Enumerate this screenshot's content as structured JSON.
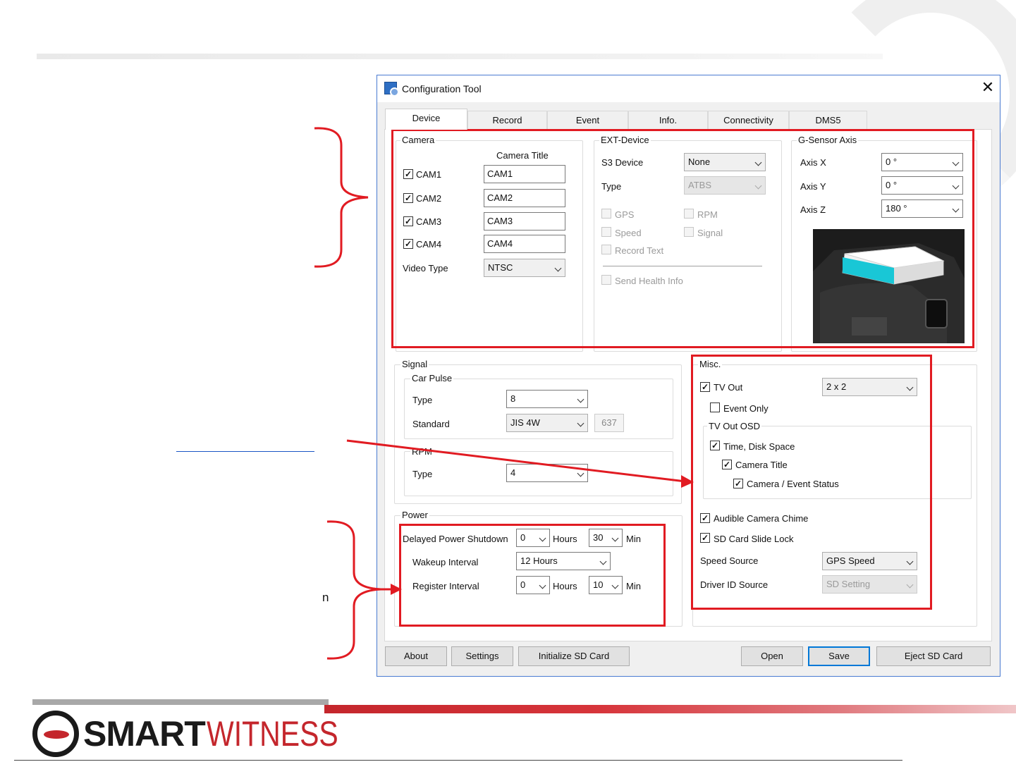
{
  "window": {
    "title": "Configuration Tool",
    "close_glyph": "✕",
    "app_icon": "config-tool-icon"
  },
  "tabs": [
    {
      "label": "Device",
      "active": true
    },
    {
      "label": "Record"
    },
    {
      "label": "Event"
    },
    {
      "label": "Info."
    },
    {
      "label": "Connectivity"
    },
    {
      "label": "DMS5"
    }
  ],
  "camera": {
    "legend": "Camera",
    "title_header": "Camera Title",
    "rows": [
      {
        "label": "CAM1",
        "checked": true,
        "title": "CAM1"
      },
      {
        "label": "CAM2",
        "checked": true,
        "title": "CAM2"
      },
      {
        "label": "CAM3",
        "checked": true,
        "title": "CAM3"
      },
      {
        "label": "CAM4",
        "checked": true,
        "title": "CAM4"
      }
    ],
    "video_type_label": "Video Type",
    "video_type_value": "NTSC"
  },
  "ext_device": {
    "legend": "EXT-Device",
    "s3_label": "S3 Device",
    "s3_value": "None",
    "type_label": "Type",
    "type_value": "ATBS",
    "gps": "GPS",
    "rpm": "RPM",
    "speed": "Speed",
    "signal": "Signal",
    "record_text": "Record Text",
    "send_health": "Send Health Info"
  },
  "gsensor": {
    "legend": "G-Sensor Axis",
    "axis_x_label": "Axis X",
    "axis_x_value": "0 °",
    "axis_y_label": "Axis Y",
    "axis_y_value": "0 °",
    "axis_z_label": "Axis Z",
    "axis_z_value": "180 °"
  },
  "signal": {
    "legend": "Signal",
    "car_pulse_legend": "Car Pulse",
    "type_label": "Type",
    "type_value": "8",
    "standard_label": "Standard",
    "standard_value": "JIS 4W",
    "standard_readonly": "637",
    "rpm_legend": "RPM",
    "rpm_type_label": "Type",
    "rpm_type_value": "4"
  },
  "power": {
    "legend": "Power",
    "delayed_label": "Delayed Power Shutdown",
    "delayed_hours": "0",
    "hours_unit": "Hours",
    "delayed_min": "30",
    "min_unit": "Min",
    "wakeup_label": "Wakeup Interval",
    "wakeup_value": "12 Hours",
    "register_label": "Register Interval",
    "register_hours": "0",
    "register_min": "10"
  },
  "misc": {
    "legend": "Misc.",
    "tv_out": "TV Out",
    "tv_out_value": "2 x 2",
    "event_only": "Event Only",
    "tv_out_osd_legend": "TV Out OSD",
    "time_disk": "Time, Disk Space",
    "camera_title": "Camera Title",
    "camera_event_status": "Camera / Event Status",
    "audible_chime": "Audible Camera Chime",
    "sd_slide_lock": "SD Card Slide Lock",
    "speed_source_label": "Speed Source",
    "speed_source_value": "GPS Speed",
    "driver_id_label": "Driver ID Source",
    "driver_id_value": "SD Setting"
  },
  "buttons": {
    "about": "About",
    "settings": "Settings",
    "init_sd": "Initialize SD Card",
    "open": "Open",
    "save": "Save",
    "eject": "Eject SD Card"
  },
  "slide": {
    "logo_smart": "SMART",
    "logo_witness": "WITNESS",
    "stray_char": "n"
  },
  "colors": {
    "annotation_red": "#e11b22",
    "brand_red": "#c4262c",
    "window_border": "#4a7bd1",
    "default_button": "#0078d7",
    "highlight_cyan": "#19c7d6"
  }
}
